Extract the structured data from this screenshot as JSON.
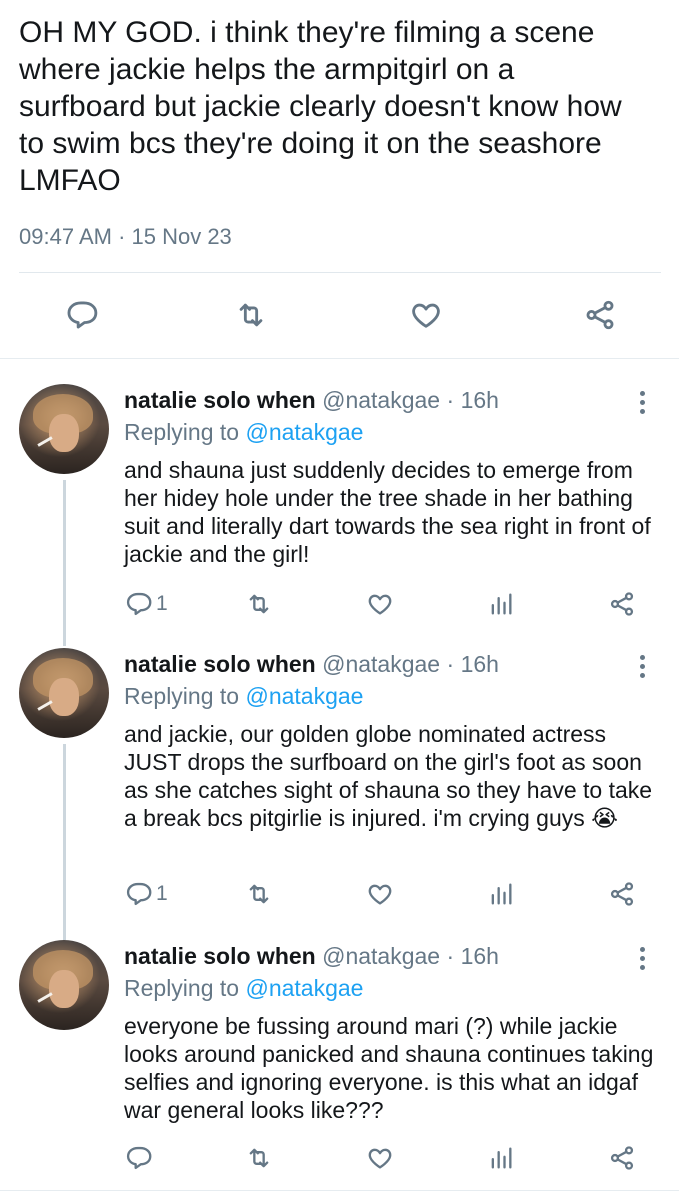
{
  "main_tweet": {
    "text": "OH MY GOD. i think they're filming a scene\nwhere jackie helps the armpitgirl on a\nsurfboard but jackie clearly doesn't know how\nto swim bcs they're doing it on the seashore\nLMFAO",
    "timestamp": "09:47 AM · 15 Nov 23",
    "actions": [
      "reply-icon",
      "retweet-icon",
      "like-icon",
      "share-icon"
    ]
  },
  "replies": [
    {
      "name": "natalie solo when",
      "handle": "@natakgae",
      "dot": "·",
      "age": "16h",
      "replying_prefix": "Replying to",
      "replying_to": "@natakgae",
      "text": "and shauna just suddenly decides to emerge from her hidey hole under the tree shade in her bathing suit and literally dart towards the sea right in front of jackie and the girl!",
      "reply_count": "1"
    },
    {
      "name": "natalie solo when",
      "handle": "@natakgae",
      "dot": "·",
      "age": "16h",
      "replying_prefix": "Replying to",
      "replying_to": "@natakgae",
      "text": "and jackie, our golden globe nominated actress JUST drops the surfboard on the girl's foot as soon as she catches sight of shauna so they have to take a break bcs pitgirlie is injured. i'm crying guys 😭",
      "reply_count": "1"
    },
    {
      "name": "natalie solo when",
      "handle": "@natakgae",
      "dot": "·",
      "age": "16h",
      "replying_prefix": "Replying to",
      "replying_to": "@natakgae",
      "text": "everyone be fussing around mari (?) while jackie looks around panicked and shauna continues taking selfies and ignoring everyone. is this what an idgaf war general looks like???",
      "reply_count": ""
    }
  ],
  "colors": {
    "text": "#14171a",
    "secondary": "#657786",
    "link": "#1da1f2",
    "divider": "#e1e8ed",
    "thread_line": "#ccd6dd"
  }
}
